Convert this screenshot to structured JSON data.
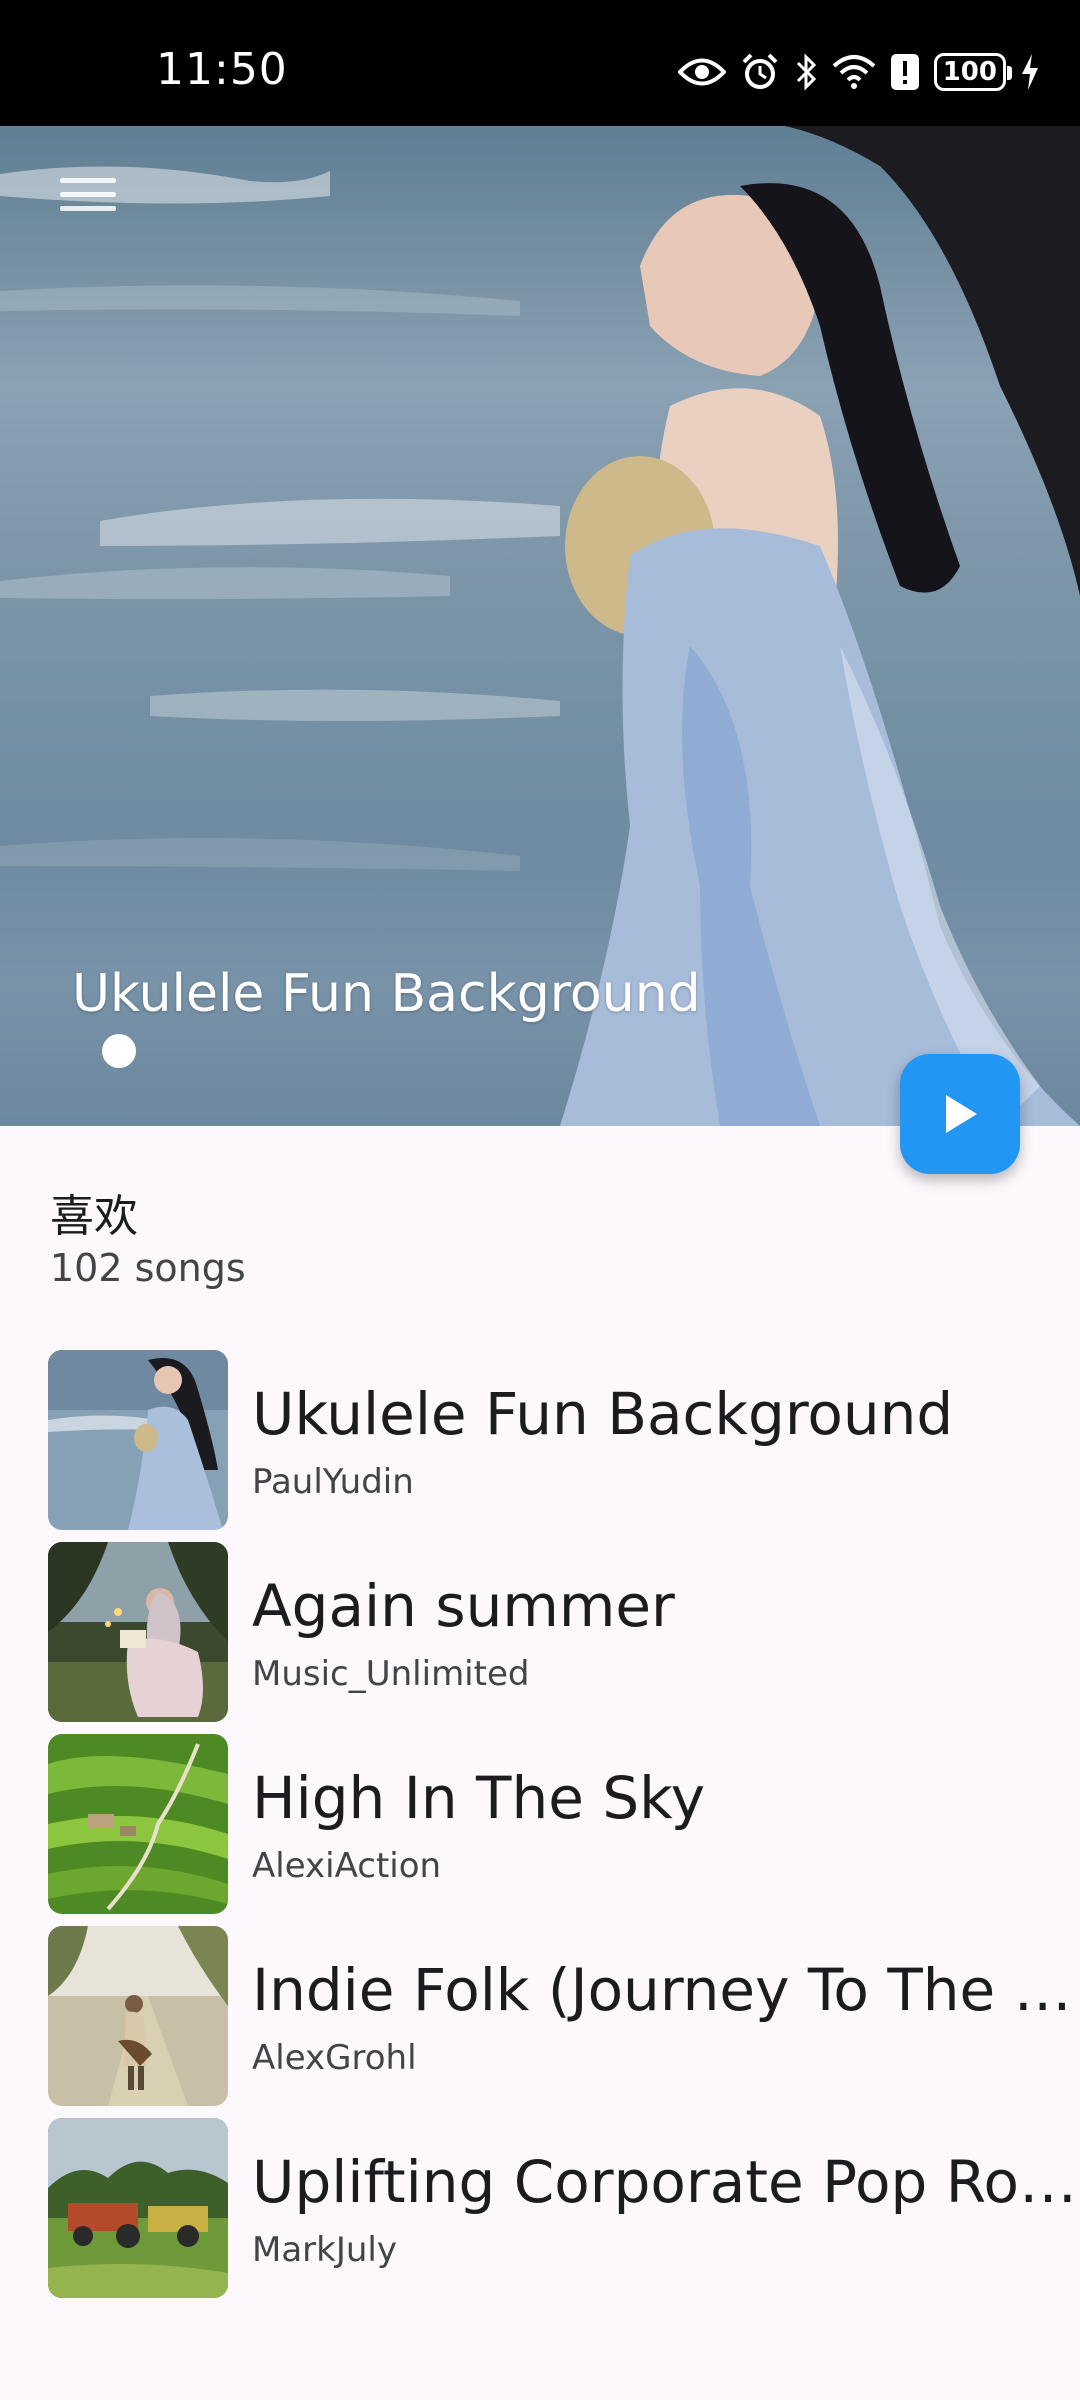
{
  "status_bar": {
    "time": "11:50",
    "battery": "100",
    "icons": [
      "eye-icon",
      "alarm-icon",
      "bluetooth-icon",
      "wifi-icon",
      "alert-icon",
      "battery-icon",
      "charging-icon"
    ]
  },
  "hero": {
    "now_playing_title": "Ukulele Fun Background",
    "menu_icon": "hamburger-menu-icon",
    "play_icon": "play-icon"
  },
  "playlist": {
    "name": "喜欢",
    "count": "102 songs"
  },
  "songs": [
    {
      "title": "Ukulele Fun Background",
      "artist": "PaulYudin"
    },
    {
      "title": "Again summer",
      "artist": "Music_Unlimited"
    },
    {
      "title": "High In The Sky",
      "artist": "AlexiAction"
    },
    {
      "title": "Indie Folk (Journey To The Heart)",
      "artist": "AlexGrohl"
    },
    {
      "title": "Uplifting Corporate Pop Rock",
      "artist": "MarkJuly"
    }
  ],
  "colors": {
    "accent": "#2196f3",
    "background": "#fcf8fc",
    "status_bar": "#000000"
  }
}
